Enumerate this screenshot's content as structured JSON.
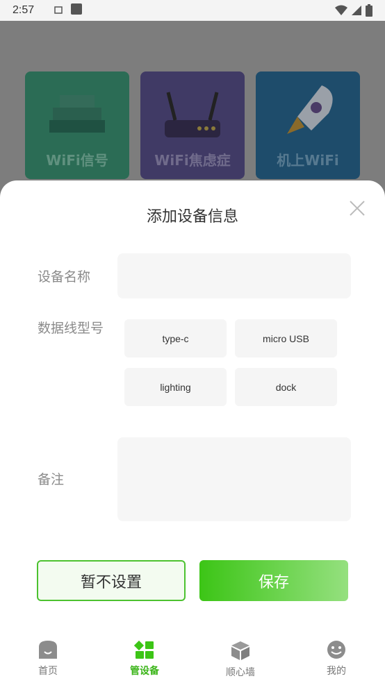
{
  "status": {
    "time": "2:57"
  },
  "background": {
    "cards": [
      {
        "label": "WiFi信号"
      },
      {
        "label": "WiFi焦虑症"
      },
      {
        "label": "机上WiFi"
      }
    ]
  },
  "dialog": {
    "title": "添加设备信息",
    "name_label": "设备名称",
    "name_value": "",
    "cable_label": "数据线型号",
    "cable_options": [
      "type-c",
      "micro USB",
      "lighting",
      "dock"
    ],
    "note_label": "备注",
    "note_value": "",
    "skip_button": "暂不设置",
    "save_button": "保存"
  },
  "nav": {
    "items": [
      {
        "label": "首页"
      },
      {
        "label": "管设备"
      },
      {
        "label": "顺心墙"
      },
      {
        "label": "我的"
      }
    ],
    "active_index": 1
  },
  "colors": {
    "accent": "#3cc516",
    "accent_light": "#95e07f"
  }
}
